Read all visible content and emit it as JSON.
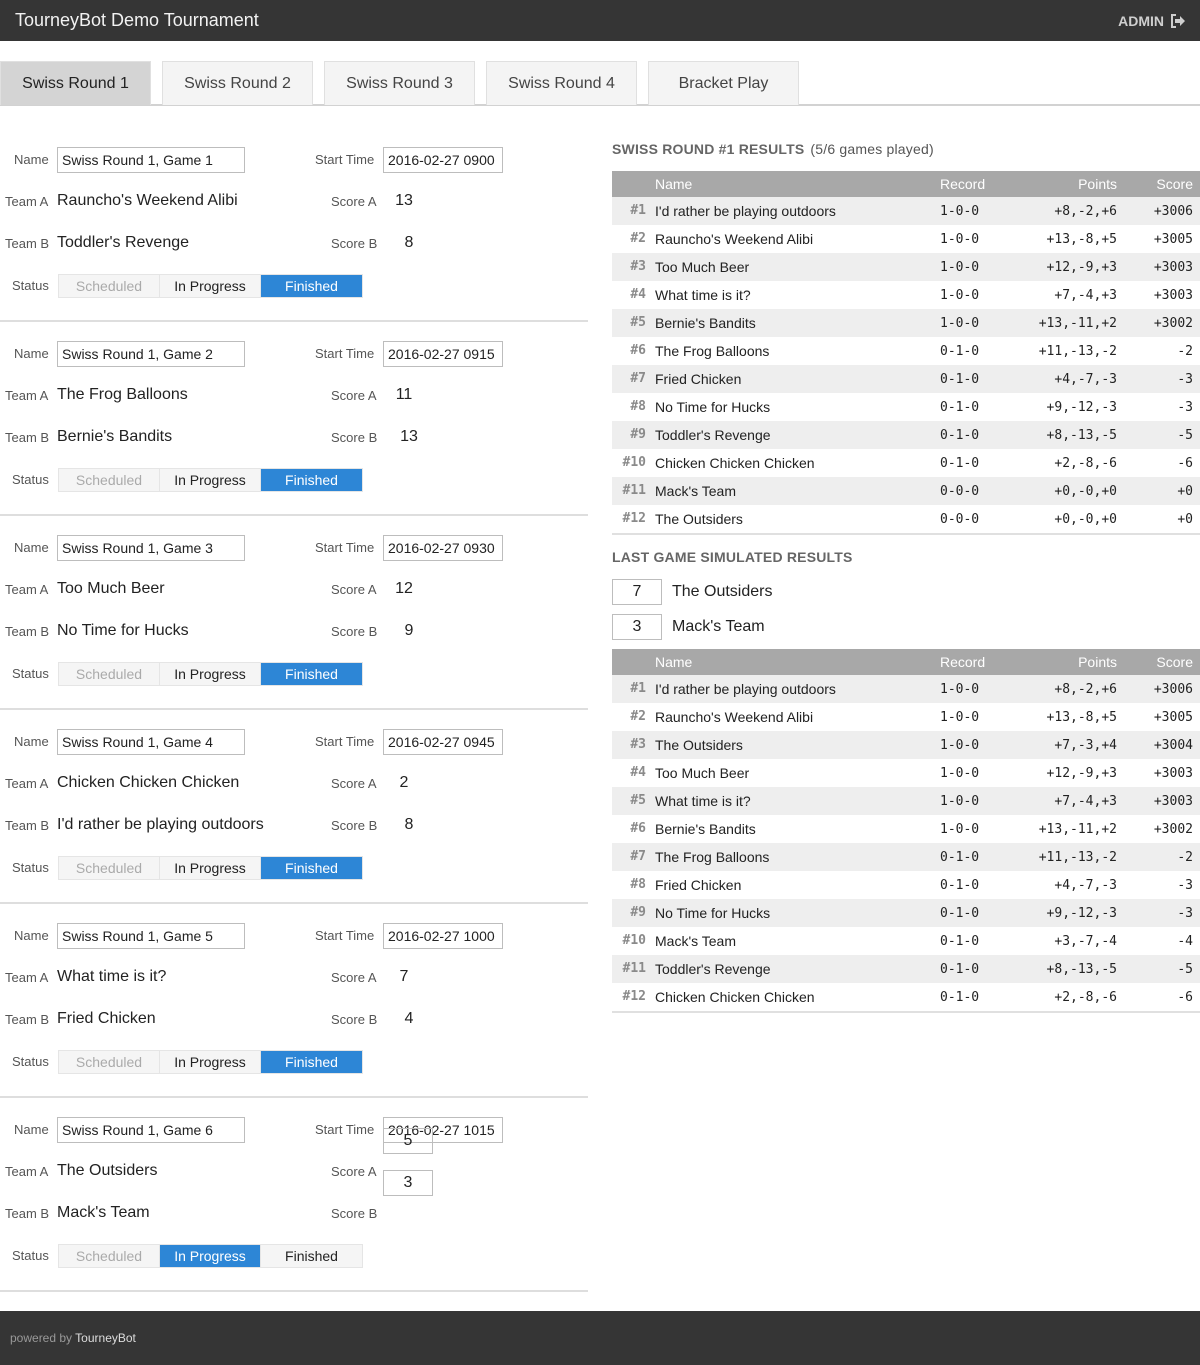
{
  "header": {
    "title": "TourneyBot Demo Tournament",
    "admin_label": "ADMIN"
  },
  "tabs": [
    "Swiss Round 1",
    "Swiss Round 2",
    "Swiss Round 3",
    "Swiss Round 4",
    "Bracket Play"
  ],
  "active_tab": "Swiss Round 1",
  "labels": {
    "name": "Name",
    "start_time": "Start Time",
    "team_a": "Team A",
    "team_b": "Team B",
    "score_a": "Score A",
    "score_b": "Score B",
    "status": "Status",
    "status_options": [
      "Scheduled",
      "In Progress",
      "Finished"
    ]
  },
  "games": [
    {
      "name": "Swiss Round 1, Game 1",
      "start_time": "2016-02-27 0900",
      "team_a": "Rauncho's Weekend Alibi",
      "team_b": "Toddler's Revenge",
      "score_a": "13",
      "score_b": "8",
      "status": "Finished"
    },
    {
      "name": "Swiss Round 1, Game 2",
      "start_time": "2016-02-27 0915",
      "team_a": "The Frog Balloons",
      "team_b": "Bernie's Bandits",
      "score_a": "11",
      "score_b": "13",
      "status": "Finished"
    },
    {
      "name": "Swiss Round 1, Game 3",
      "start_time": "2016-02-27 0930",
      "team_a": "Too Much Beer",
      "team_b": "No Time for Hucks",
      "score_a": "12",
      "score_b": "9",
      "status": "Finished"
    },
    {
      "name": "Swiss Round 1, Game 4",
      "start_time": "2016-02-27 0945",
      "team_a": "Chicken Chicken Chicken",
      "team_b": "I'd rather be playing outdoors",
      "score_a": "2",
      "score_b": "8",
      "status": "Finished"
    },
    {
      "name": "Swiss Round 1, Game 5",
      "start_time": "2016-02-27 1000",
      "team_a": "What time is it?",
      "team_b": "Fried Chicken",
      "score_a": "7",
      "score_b": "4",
      "status": "Finished"
    },
    {
      "name": "Swiss Round 1, Game 6",
      "start_time": "2016-02-27 1015",
      "team_a": "The Outsiders",
      "team_b": "Mack's Team",
      "score_a": "5",
      "score_b": "3",
      "status": "In Progress"
    }
  ],
  "results": {
    "title": "SWISS ROUND #1 RESULTS",
    "subtitle": "(5/6 games played)",
    "columns": [
      "Name",
      "Record",
      "Points",
      "Score"
    ],
    "rows": [
      {
        "rank": "#1",
        "name": "I'd rather be playing outdoors",
        "record": "1-0-0",
        "points": "+8,-2,+6",
        "score": "+3006"
      },
      {
        "rank": "#2",
        "name": "Rauncho's Weekend Alibi",
        "record": "1-0-0",
        "points": "+13,-8,+5",
        "score": "+3005"
      },
      {
        "rank": "#3",
        "name": "Too Much Beer",
        "record": "1-0-0",
        "points": "+12,-9,+3",
        "score": "+3003"
      },
      {
        "rank": "#4",
        "name": "What time is it?",
        "record": "1-0-0",
        "points": "+7,-4,+3",
        "score": "+3003"
      },
      {
        "rank": "#5",
        "name": "Bernie's Bandits",
        "record": "1-0-0",
        "points": "+13,-11,+2",
        "score": "+3002"
      },
      {
        "rank": "#6",
        "name": "The Frog Balloons",
        "record": "0-1-0",
        "points": "+11,-13,-2",
        "score": "-2"
      },
      {
        "rank": "#7",
        "name": "Fried Chicken",
        "record": "0-1-0",
        "points": "+4,-7,-3",
        "score": "-3"
      },
      {
        "rank": "#8",
        "name": "No Time for Hucks",
        "record": "0-1-0",
        "points": "+9,-12,-3",
        "score": "-3"
      },
      {
        "rank": "#9",
        "name": "Toddler's Revenge",
        "record": "0-1-0",
        "points": "+8,-13,-5",
        "score": "-5"
      },
      {
        "rank": "#10",
        "name": "Chicken Chicken Chicken",
        "record": "0-1-0",
        "points": "+2,-8,-6",
        "score": "-6"
      },
      {
        "rank": "#11",
        "name": "Mack's Team",
        "record": "0-0-0",
        "points": "+0,-0,+0",
        "score": "+0"
      },
      {
        "rank": "#12",
        "name": "The Outsiders",
        "record": "0-0-0",
        "points": "+0,-0,+0",
        "score": "+0"
      }
    ]
  },
  "simulated": {
    "title": "LAST GAME SIMULATED RESULTS",
    "team_a_score": "7",
    "team_a": "The Outsiders",
    "team_b_score": "3",
    "team_b": "Mack's Team",
    "rows": [
      {
        "rank": "#1",
        "name": "I'd rather be playing outdoors",
        "record": "1-0-0",
        "points": "+8,-2,+6",
        "score": "+3006"
      },
      {
        "rank": "#2",
        "name": "Rauncho's Weekend Alibi",
        "record": "1-0-0",
        "points": "+13,-8,+5",
        "score": "+3005"
      },
      {
        "rank": "#3",
        "name": "The Outsiders",
        "record": "1-0-0",
        "points": "+7,-3,+4",
        "score": "+3004"
      },
      {
        "rank": "#4",
        "name": "Too Much Beer",
        "record": "1-0-0",
        "points": "+12,-9,+3",
        "score": "+3003"
      },
      {
        "rank": "#5",
        "name": "What time is it?",
        "record": "1-0-0",
        "points": "+7,-4,+3",
        "score": "+3003"
      },
      {
        "rank": "#6",
        "name": "Bernie's Bandits",
        "record": "1-0-0",
        "points": "+13,-11,+2",
        "score": "+3002"
      },
      {
        "rank": "#7",
        "name": "The Frog Balloons",
        "record": "0-1-0",
        "points": "+11,-13,-2",
        "score": "-2"
      },
      {
        "rank": "#8",
        "name": "Fried Chicken",
        "record": "0-1-0",
        "points": "+4,-7,-3",
        "score": "-3"
      },
      {
        "rank": "#9",
        "name": "No Time for Hucks",
        "record": "0-1-0",
        "points": "+9,-12,-3",
        "score": "-3"
      },
      {
        "rank": "#10",
        "name": "Mack's Team",
        "record": "0-1-0",
        "points": "+3,-7,-4",
        "score": "-4"
      },
      {
        "rank": "#11",
        "name": "Toddler's Revenge",
        "record": "0-1-0",
        "points": "+8,-13,-5",
        "score": "-5"
      },
      {
        "rank": "#12",
        "name": "Chicken Chicken Chicken",
        "record": "0-1-0",
        "points": "+2,-8,-6",
        "score": "-6"
      }
    ]
  },
  "footer": {
    "powered_by": "powered by",
    "brand": "TourneyBot"
  },
  "colors": {
    "header_bg": "#353535",
    "accent": "#2d86d6",
    "table_header": "#a8a8a8"
  },
  "icons": {
    "admin": "sign-out-icon"
  }
}
